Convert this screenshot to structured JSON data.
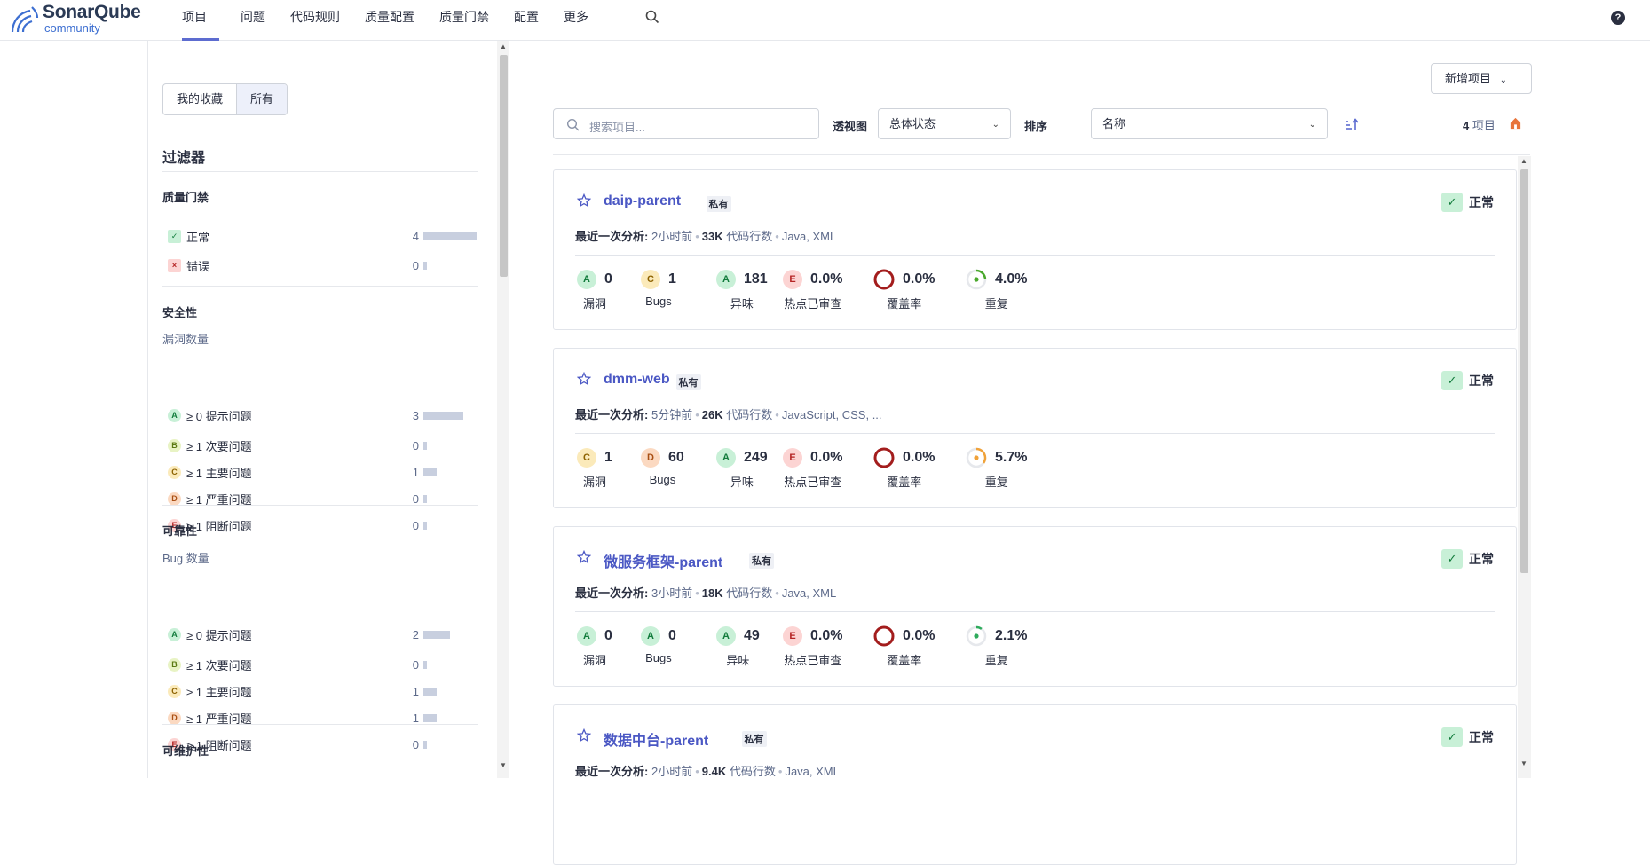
{
  "brand": {
    "name": "SonarQube",
    "edition": "community"
  },
  "nav": {
    "items": [
      "项目",
      "问题",
      "代码规则",
      "质量配置",
      "质量门禁",
      "配置",
      "更多"
    ],
    "active": "项目"
  },
  "help": "?",
  "sidebar": {
    "toggle": {
      "favorites": "我的收藏",
      "all": "所有"
    },
    "title": "过滤器",
    "quality_gate": {
      "title": "质量门禁",
      "items": [
        {
          "label": "正常",
          "count": "4",
          "icon": "check-icon",
          "bar": 1.0
        },
        {
          "label": "错误",
          "count": "0",
          "icon": "cross-icon",
          "bar": 0
        }
      ]
    },
    "security": {
      "title": "安全性",
      "sub": "漏洞数量",
      "items": [
        {
          "grade": "A",
          "label": "≥ 0 提示问题",
          "count": "3",
          "bar": 0.75
        },
        {
          "grade": "B",
          "label": "≥ 1 次要问题",
          "count": "0",
          "bar": 0
        },
        {
          "grade": "C",
          "label": "≥ 1 主要问题",
          "count": "1",
          "bar": 0.25
        },
        {
          "grade": "D",
          "label": "≥ 1 严重问题",
          "count": "0",
          "bar": 0
        },
        {
          "grade": "E",
          "label": "≥ 1 阻断问题",
          "count": "0",
          "bar": 0
        }
      ]
    },
    "reliability": {
      "title": "可靠性",
      "sub": "Bug 数量",
      "items": [
        {
          "grade": "A",
          "label": "≥ 0 提示问题",
          "count": "2",
          "bar": 0.5
        },
        {
          "grade": "B",
          "label": "≥ 1 次要问题",
          "count": "0",
          "bar": 0
        },
        {
          "grade": "C",
          "label": "≥ 1 主要问题",
          "count": "1",
          "bar": 0.25
        },
        {
          "grade": "D",
          "label": "≥ 1 严重问题",
          "count": "1",
          "bar": 0.25
        },
        {
          "grade": "E",
          "label": "≥ 1 阻断问题",
          "count": "0",
          "bar": 0
        }
      ]
    },
    "maintainability": {
      "title": "可维护性"
    }
  },
  "toolbar": {
    "add_project": "新增项目",
    "search_placeholder": "搜索项目...",
    "view_label": "透视图",
    "view_value": "总体状态",
    "sort_label": "排序",
    "sort_value": "名称",
    "project_count": "4",
    "project_count_unit": "项目"
  },
  "projects": [
    {
      "name": "daip-parent",
      "visibility": "私有",
      "status": "正常",
      "meta": {
        "label": "最近一次分析:",
        "time": "2小时前",
        "loc": "33K",
        "loc_label": "代码行数",
        "langs": "Java, XML"
      },
      "metrics": {
        "vuln_grade": "A",
        "vulns": "0",
        "bug_grade": "C",
        "bugs": "1",
        "smell_grade": "A",
        "smells": "181",
        "hotspot_grade": "E",
        "hotspots": "0.0%",
        "coverage": "0.0%",
        "dup": "4.0%",
        "dup_color": "#4aa82c",
        "dup_fraction": 0.25
      }
    },
    {
      "name": "dmm-web",
      "visibility": "私有",
      "status": "正常",
      "meta": {
        "label": "最近一次分析:",
        "time": "5分钟前",
        "loc": "26K",
        "loc_label": "代码行数",
        "langs": "JavaScript, CSS, ..."
      },
      "metrics": {
        "vuln_grade": "C",
        "vulns": "1",
        "bug_grade": "D",
        "bugs": "60",
        "smell_grade": "A",
        "smells": "249",
        "hotspot_grade": "E",
        "hotspots": "0.0%",
        "coverage": "0.0%",
        "dup": "5.7%",
        "dup_color": "#f0a239",
        "dup_fraction": 0.35
      }
    },
    {
      "name": "微服务框架-parent",
      "visibility": "私有",
      "status": "正常",
      "meta": {
        "label": "最近一次分析:",
        "time": "3小时前",
        "loc": "18K",
        "loc_label": "代码行数",
        "langs": "Java, XML"
      },
      "metrics": {
        "vuln_grade": "A",
        "vulns": "0",
        "bug_grade": "A",
        "bugs": "0",
        "smell_grade": "A",
        "smells": "49",
        "hotspot_grade": "E",
        "hotspots": "0.0%",
        "coverage": "0.0%",
        "dup": "2.1%",
        "dup_color": "#2eab5c",
        "dup_fraction": 0.1
      }
    },
    {
      "name": "数据中台-parent",
      "visibility": "私有",
      "status": "正常",
      "meta": {
        "label": "最近一次分析:",
        "time": "2小时前",
        "loc": "9.4K",
        "loc_label": "代码行数",
        "langs": "Java, XML"
      }
    }
  ],
  "metric_labels": {
    "vulns": "漏洞",
    "bugs": "Bugs",
    "smells": "异味",
    "hotspots": "热点已审查",
    "coverage": "覆盖率",
    "dup": "重复"
  },
  "colors": {
    "accent": "#5d6cd0",
    "link": "#4b58c4",
    "passed": "#117b3b",
    "coverage_ring": "#a31d1d"
  }
}
